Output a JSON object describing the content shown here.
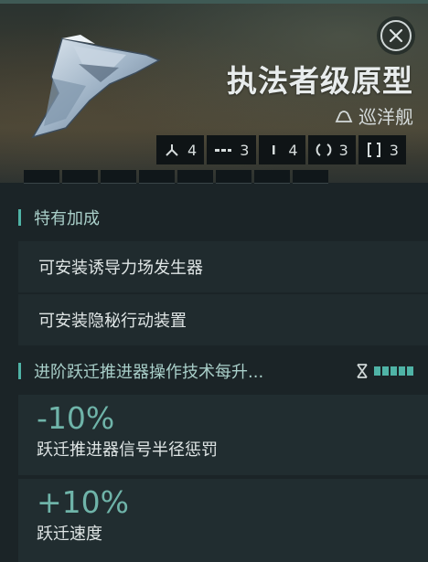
{
  "header": {
    "title": "执法者级原型",
    "ship_class": "巡洋舰",
    "close_icon": "close-icon",
    "class_icon": "cruiser-icon"
  },
  "slots": [
    {
      "icon": "turret-hardpoint-icon",
      "count": "4"
    },
    {
      "icon": "high-slot-icon",
      "count": "3"
    },
    {
      "icon": "mid-slot-icon",
      "count": "4"
    },
    {
      "icon": "low-slot-icon",
      "count": "3"
    },
    {
      "icon": "rig-slot-icon",
      "count": "3"
    }
  ],
  "special_bonus": {
    "heading": "特有加成",
    "items": [
      "可安装诱导力场发生器",
      "可安装隐秘行动装置"
    ]
  },
  "skill_bonus": {
    "heading": "进阶跃迁推进器操作技术每升...",
    "level_icon": "skill-level-icon",
    "level_pips": 5,
    "items": [
      {
        "value": "-10%",
        "description": "跃迁推进器信号半径惩罚"
      },
      {
        "value": "+10%",
        "description": "跃迁速度"
      }
    ]
  },
  "colors": {
    "accent": "#4fb3a6",
    "bonus_value": "#6fb4a9",
    "background": "#1b2427"
  }
}
